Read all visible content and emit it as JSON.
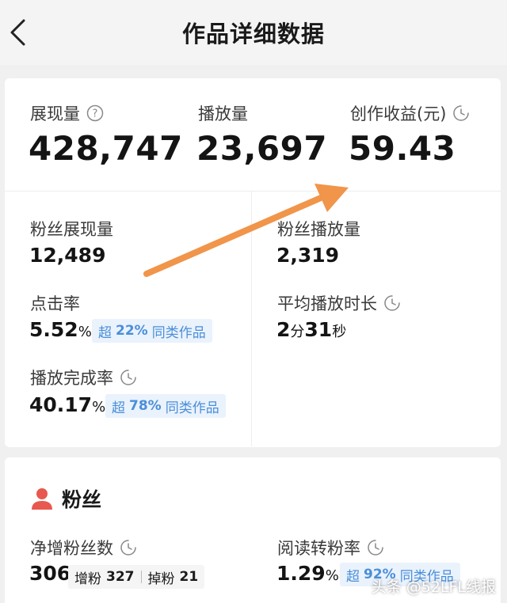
{
  "header": {
    "title": "作品详细数据"
  },
  "overview": {
    "impressions": {
      "label": "展现量",
      "value": "428,747"
    },
    "plays": {
      "label": "播放量",
      "value": "23,697"
    },
    "earnings": {
      "label": "创作收益(元)",
      "value": "59.43"
    }
  },
  "details": {
    "fan_impressions": {
      "label": "粉丝展现量",
      "value": "12,489"
    },
    "fan_plays": {
      "label": "粉丝播放量",
      "value": "2,319"
    },
    "ctr": {
      "label": "点击率",
      "value": "5.52",
      "unit": "%",
      "badge_prefix": "超",
      "badge_value": "22%",
      "badge_suffix": "同类作品"
    },
    "avg_duration": {
      "label": "平均播放时长",
      "min": "2",
      "min_unit": "分",
      "sec": "31",
      "sec_unit": "秒"
    },
    "completion": {
      "label": "播放完成率",
      "value": "40.17",
      "unit": "%",
      "badge_prefix": "超",
      "badge_value": "78%",
      "badge_suffix": "同类作品"
    }
  },
  "fans": {
    "title": "粉丝",
    "net_gain": {
      "label": "净增粉丝数",
      "value": "306",
      "gain_label": "增粉",
      "gain_value": "327",
      "loss_label": "掉粉",
      "loss_value": "21"
    },
    "conversion": {
      "label": "阅读转粉率",
      "value": "1.29",
      "unit": "%",
      "badge_prefix": "超",
      "badge_value": "92%",
      "badge_suffix": "同类作品"
    }
  },
  "watermark": "头条 @52LFL线报",
  "colors": {
    "accent_blue": "#4a8fd9",
    "badge_bg": "#eaf2fc",
    "arrow": "#f0954a",
    "fans_icon": "#e8584f"
  }
}
